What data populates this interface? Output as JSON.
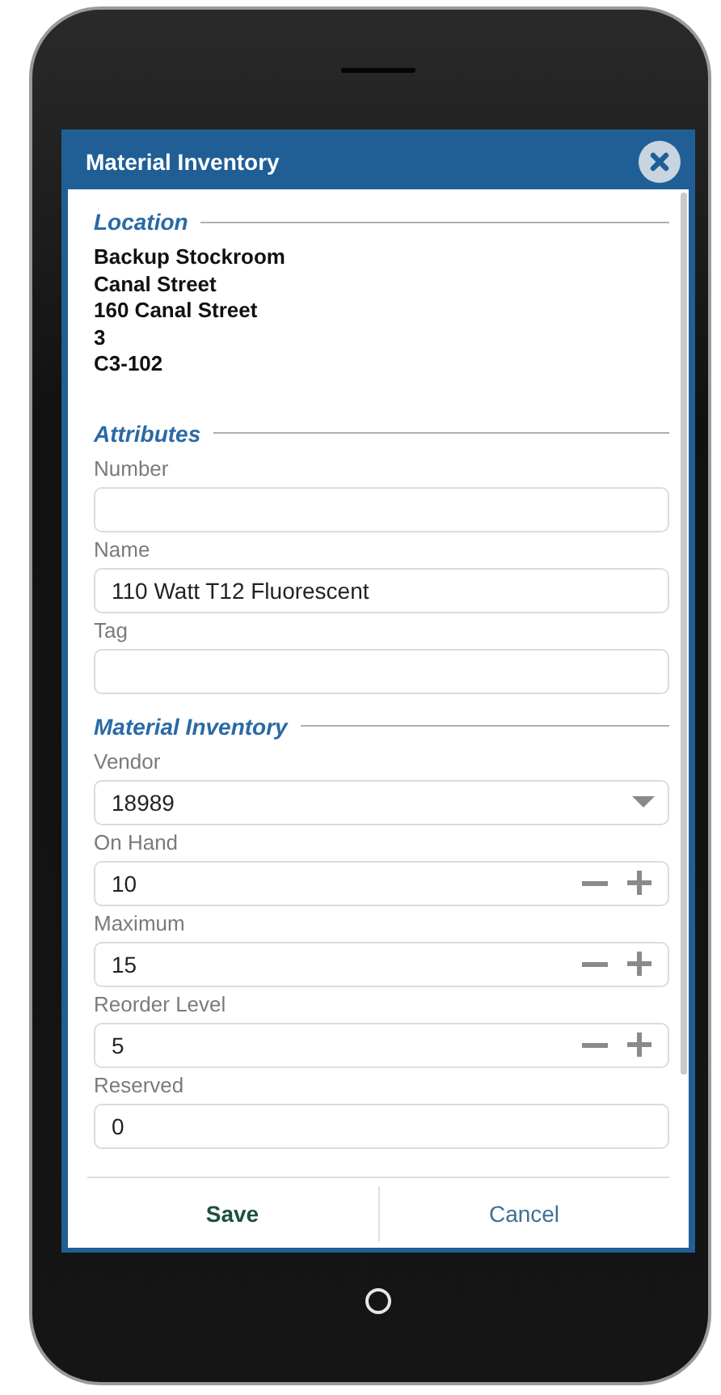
{
  "dialog": {
    "title": "Material Inventory"
  },
  "sections": [
    {
      "title": "Location",
      "kind": "lines",
      "lines": [
        "Backup Stockroom",
        "Canal Street",
        "160 Canal Street",
        "3",
        "C3-102"
      ]
    },
    {
      "title": "Attributes",
      "kind": "fields",
      "fields": [
        {
          "label": "Number",
          "kind": "text"
        },
        {
          "label": "Name",
          "kind": "text",
          "value": "110 Watt T12 Fluorescent"
        },
        {
          "label": "Tag",
          "kind": "text"
        }
      ]
    },
    {
      "title": "Material Inventory",
      "kind": "fields",
      "fields": [
        {
          "label": "Vendor",
          "kind": "select",
          "value": "18989"
        },
        {
          "label": "On Hand",
          "kind": "stepper",
          "value": "10"
        },
        {
          "label": "Maximum",
          "kind": "stepper",
          "value": "15"
        },
        {
          "label": "Reorder Level",
          "kind": "stepper",
          "value": "5"
        },
        {
          "label": "Reserved",
          "kind": "text",
          "value": "0"
        }
      ]
    }
  ],
  "buttons": [
    {
      "label": "Save",
      "kind": "primary"
    },
    {
      "label": "Cancel",
      "kind": "secondary"
    }
  ]
}
